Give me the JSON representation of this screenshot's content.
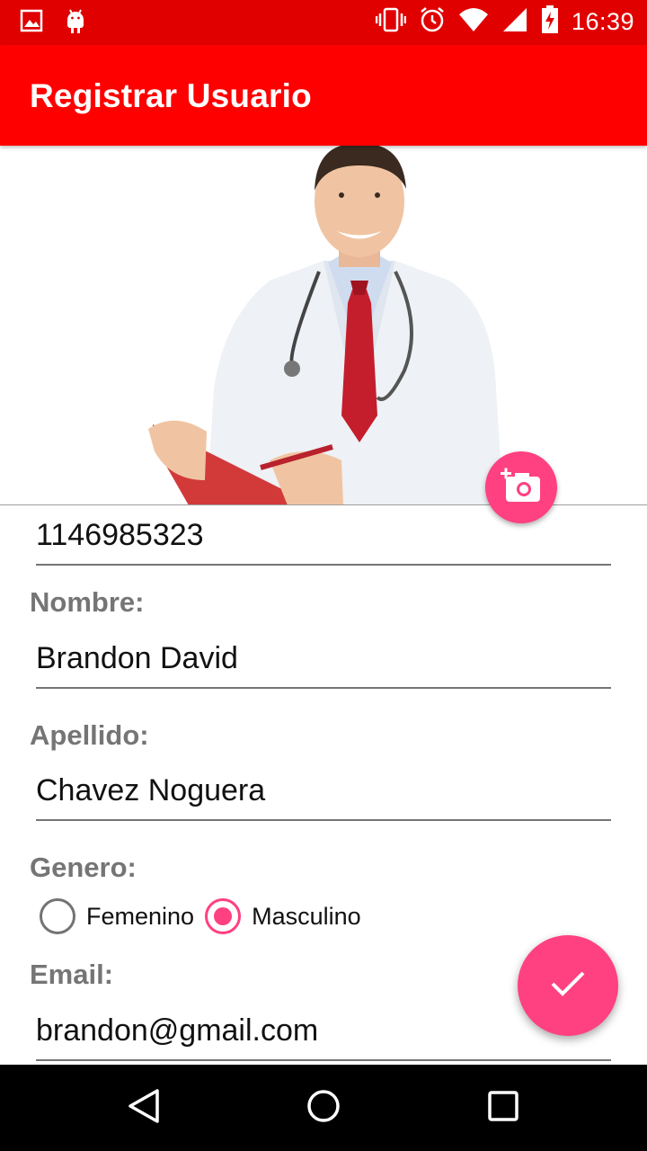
{
  "status_bar": {
    "time": "16:39",
    "left_icons": [
      "image-icon",
      "android-icon"
    ],
    "right_icons": [
      "vibrate-icon",
      "alarm-icon",
      "wifi-icon",
      "signal-icon",
      "battery-charging-icon"
    ]
  },
  "app_bar": {
    "title": "Registrar Usuario",
    "color": "#ff0000"
  },
  "photo": {
    "camera_button_icon": "add-photo-icon"
  },
  "form": {
    "document_value": "1146985323",
    "nombre_label": "Nombre:",
    "nombre_value": "Brandon David",
    "apellido_label": "Apellido:",
    "apellido_value": "Chavez Noguera",
    "genero_label": "Genero:",
    "genero_options": [
      "Femenino",
      "Masculino"
    ],
    "genero_selected": "Masculino",
    "email_label": "Email:",
    "email_value": "brandon@gmail.com"
  },
  "fab": {
    "icon": "check-icon",
    "color": "#ff4081"
  },
  "nav_bar": {
    "buttons": [
      "back-icon",
      "home-icon",
      "recents-icon"
    ]
  }
}
